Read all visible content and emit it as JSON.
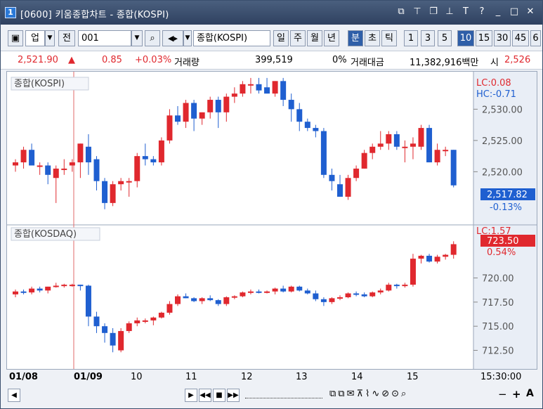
{
  "window": {
    "title": "[0600] 키움종합차트 - 종합(KOSPI)",
    "icon_label": "1",
    "title_icons": [
      "restore-tile-icon",
      "pin-icon",
      "copy-window-icon",
      "fix-icon",
      "text-T-icon",
      "help-icon",
      "minimize-icon",
      "maximize-icon",
      "close-icon"
    ]
  },
  "toolbar": {
    "type_label": "업",
    "prev_label": "전",
    "code_value": "001",
    "search_icon": "search-icon",
    "sound_icon": "sound-icon",
    "name_value": "종합(KOSPI)",
    "period_buttons": [
      "일",
      "주",
      "월",
      "년",
      "분",
      "초",
      "틱"
    ],
    "selected_period": "분",
    "interval_buttons": [
      "1",
      "3",
      "5",
      "10",
      "15",
      "30",
      "45",
      "6"
    ],
    "selected_interval": "10"
  },
  "quote": {
    "price": "2,521.90",
    "change_arrow": "▲",
    "change": "0.85",
    "change_pct": "+0.03%",
    "volume_label": "거래량",
    "volume": "399,519",
    "volume_ratio": "0%",
    "amount_label": "거래대금",
    "amount": "11,382,916백만",
    "open_label": "시",
    "open": "2,526"
  },
  "panels": {
    "top": {
      "label": "종합(KOSPI)",
      "lc": "LC:0.08",
      "hc": "HC:-0.71",
      "current_value": "2,517.82",
      "current_pct": "-0.13%",
      "yticks": [
        "2,530.00",
        "2,525.00",
        "2,520.00"
      ]
    },
    "bottom": {
      "label": "종합(KOSDAQ)",
      "lc": "LC:1.57",
      "current_value": "723.50",
      "current_pct": "0.54%",
      "yticks": [
        "720.00",
        "717.50",
        "715.00",
        "712.50"
      ]
    }
  },
  "xaxis": {
    "labels": [
      "01/08",
      "01/09",
      "10",
      "11",
      "12",
      "13",
      "14",
      "15"
    ],
    "time": "15:30:00"
  },
  "colors": {
    "up": "#e0282e",
    "down": "#1f5fd0",
    "accent": "#2f5fa8"
  },
  "chart_data": [
    {
      "type": "candlestick",
      "name": "종합(KOSPI)",
      "yticks": [
        2520,
        2525,
        2530
      ],
      "ohlc": [
        [
          2521.0,
          2522.0,
          2520.0,
          2521.5
        ],
        [
          2521.5,
          2524.0,
          2520.5,
          2523.5
        ],
        [
          2523.5,
          2524.5,
          2521.5,
          2521.0
        ],
        [
          2521.0,
          2521.5,
          2519.5,
          2521.0
        ],
        [
          2521.0,
          2521.5,
          2518.0,
          2519.5
        ],
        [
          2519.0,
          2521.0,
          2515.0,
          2520.5
        ],
        [
          2520.5,
          2522.0,
          2519.5,
          2520.5
        ],
        [
          2521.0,
          2522.0,
          2520.0,
          2521.5
        ],
        [
          2521.5,
          2524.5,
          2519.0,
          2524.5
        ],
        [
          2524.0,
          2526.0,
          2519.5,
          2521.5
        ],
        [
          2522.0,
          2522.5,
          2517.0,
          2518.5
        ],
        [
          2518.5,
          2519.0,
          2514.0,
          2515.0
        ],
        [
          2515.0,
          2518.5,
          2514.5,
          2518.0
        ],
        [
          2518.0,
          2519.0,
          2517.0,
          2518.5
        ],
        [
          2518.5,
          2519.0,
          2516.0,
          2518.5
        ],
        [
          2518.5,
          2523.0,
          2517.5,
          2522.5
        ],
        [
          2522.5,
          2524.5,
          2521.0,
          2522.0
        ],
        [
          2522.0,
          2522.5,
          2521.0,
          2521.5
        ],
        [
          2521.5,
          2525.5,
          2521.0,
          2525.0
        ],
        [
          2525.0,
          2530.0,
          2524.5,
          2529.0
        ],
        [
          2529.0,
          2530.5,
          2527.5,
          2528.0
        ],
        [
          2528.0,
          2531.5,
          2527.0,
          2531.0
        ],
        [
          2531.0,
          2531.5,
          2526.5,
          2528.5
        ],
        [
          2528.5,
          2529.5,
          2527.5,
          2529.5
        ],
        [
          2529.5,
          2532.0,
          2528.5,
          2531.5
        ],
        [
          2531.5,
          2532.0,
          2527.0,
          2529.5
        ],
        [
          2529.5,
          2532.5,
          2528.0,
          2532.0
        ],
        [
          2532.0,
          2533.5,
          2531.0,
          2532.5
        ],
        [
          2532.5,
          2534.5,
          2532.0,
          2534.0
        ],
        [
          2534.0,
          2535.0,
          2532.5,
          2534.0
        ],
        [
          2534.0,
          2535.0,
          2532.5,
          2533.0
        ],
        [
          2533.5,
          2535.0,
          2532.5,
          2532.5
        ],
        [
          2532.5,
          2534.5,
          2532.0,
          2534.5
        ],
        [
          2534.5,
          2535.0,
          2530.5,
          2531.5
        ],
        [
          2531.5,
          2532.5,
          2528.0,
          2530.0
        ],
        [
          2530.0,
          2531.0,
          2526.5,
          2528.0
        ],
        [
          2528.0,
          2528.5,
          2526.5,
          2527.0
        ],
        [
          2527.0,
          2527.5,
          2525.5,
          2526.5
        ],
        [
          2526.5,
          2527.0,
          2519.0,
          2519.5
        ],
        [
          2519.5,
          2520.5,
          2517.0,
          2518.5
        ],
        [
          2518.0,
          2519.5,
          2516.0,
          2516.0
        ],
        [
          2516.0,
          2519.5,
          2515.5,
          2519.0
        ],
        [
          2519.0,
          2521.0,
          2518.5,
          2520.5
        ],
        [
          2520.5,
          2523.5,
          2520.5,
          2523.0
        ],
        [
          2523.0,
          2524.5,
          2522.0,
          2524.0
        ],
        [
          2524.0,
          2526.5,
          2523.5,
          2524.5
        ],
        [
          2524.5,
          2526.5,
          2523.5,
          2526.0
        ],
        [
          2526.0,
          2526.5,
          2523.5,
          2524.0
        ],
        [
          2524.0,
          2525.0,
          2521.5,
          2524.0
        ],
        [
          2524.0,
          2525.5,
          2522.0,
          2524.5
        ],
        [
          2524.0,
          2527.5,
          2523.5,
          2527.0
        ],
        [
          2527.0,
          2527.5,
          2521.5,
          2521.5
        ],
        [
          2521.5,
          2524.5,
          2521.0,
          2523.5
        ],
        [
          2523.5,
          2524.0,
          2522.5,
          2523.5
        ],
        [
          2523.5,
          2523.5,
          2517.5,
          2517.82
        ]
      ]
    },
    {
      "type": "candlestick",
      "name": "종합(KOSDAQ)",
      "yticks": [
        712.5,
        715.0,
        717.5,
        720.0
      ],
      "ohlc": [
        [
          718.3,
          718.8,
          718.0,
          718.6
        ],
        [
          718.6,
          718.8,
          718.3,
          718.5
        ],
        [
          718.5,
          719.1,
          718.3,
          718.9
        ],
        [
          718.9,
          719.1,
          718.5,
          718.7
        ],
        [
          718.7,
          719.1,
          718.4,
          719.1
        ],
        [
          719.1,
          719.5,
          719.0,
          719.2
        ],
        [
          719.2,
          719.4,
          719.0,
          719.3
        ],
        [
          719.3,
          719.4,
          719.1,
          719.3
        ],
        [
          719.3,
          719.3,
          718.7,
          719.2
        ],
        [
          719.2,
          719.3,
          715.0,
          716.0
        ],
        [
          716.0,
          716.5,
          714.3,
          715.0
        ],
        [
          715.0,
          715.3,
          713.3,
          714.3
        ],
        [
          714.3,
          714.8,
          712.3,
          713.0
        ],
        [
          712.5,
          714.8,
          712.3,
          714.5
        ],
        [
          714.5,
          715.5,
          714.3,
          715.3
        ],
        [
          715.3,
          715.9,
          715.0,
          715.6
        ],
        [
          715.6,
          715.8,
          715.3,
          715.6
        ],
        [
          715.6,
          716.0,
          715.1,
          715.9
        ],
        [
          715.9,
          716.5,
          715.8,
          716.4
        ],
        [
          716.4,
          717.6,
          716.2,
          717.3
        ],
        [
          717.3,
          718.3,
          717.1,
          718.1
        ],
        [
          718.1,
          718.4,
          717.9,
          717.9
        ],
        [
          717.9,
          718.0,
          717.5,
          717.6
        ],
        [
          717.6,
          718.0,
          717.3,
          717.9
        ],
        [
          717.9,
          718.2,
          717.6,
          717.7
        ],
        [
          717.7,
          717.8,
          717.1,
          717.3
        ],
        [
          717.3,
          718.1,
          717.1,
          718.0
        ],
        [
          718.0,
          718.2,
          717.8,
          718.1
        ],
        [
          718.1,
          718.6,
          718.0,
          718.5
        ],
        [
          718.5,
          718.8,
          718.3,
          718.6
        ],
        [
          718.6,
          718.8,
          718.4,
          718.5
        ],
        [
          718.5,
          718.7,
          718.4,
          718.6
        ],
        [
          718.6,
          719.0,
          718.3,
          718.9
        ],
        [
          718.9,
          719.2,
          718.5,
          718.6
        ],
        [
          718.6,
          719.2,
          718.5,
          719.1
        ],
        [
          719.1,
          719.2,
          718.6,
          718.7
        ],
        [
          718.7,
          718.9,
          718.3,
          718.4
        ],
        [
          718.4,
          718.7,
          717.6,
          717.8
        ],
        [
          717.8,
          718.0,
          717.1,
          717.5
        ],
        [
          717.5,
          718.0,
          717.3,
          717.9
        ],
        [
          717.9,
          718.2,
          717.7,
          718.0
        ],
        [
          718.0,
          718.5,
          717.9,
          718.4
        ],
        [
          718.4,
          718.6,
          718.1,
          718.3
        ],
        [
          718.3,
          718.5,
          718.0,
          718.1
        ],
        [
          718.1,
          718.6,
          718.0,
          718.5
        ],
        [
          718.5,
          718.9,
          718.3,
          718.7
        ],
        [
          718.7,
          719.5,
          718.6,
          719.3
        ],
        [
          719.3,
          719.4,
          718.9,
          719.2
        ],
        [
          719.2,
          719.5,
          719.0,
          719.3
        ],
        [
          719.3,
          722.5,
          719.1,
          722.0
        ],
        [
          722.0,
          722.4,
          721.5,
          722.3
        ],
        [
          722.3,
          722.5,
          721.6,
          721.7
        ],
        [
          721.7,
          722.4,
          721.5,
          722.2
        ],
        [
          722.2,
          722.5,
          721.9,
          722.4
        ],
        [
          722.4,
          723.8,
          722.0,
          723.5
        ]
      ]
    }
  ]
}
